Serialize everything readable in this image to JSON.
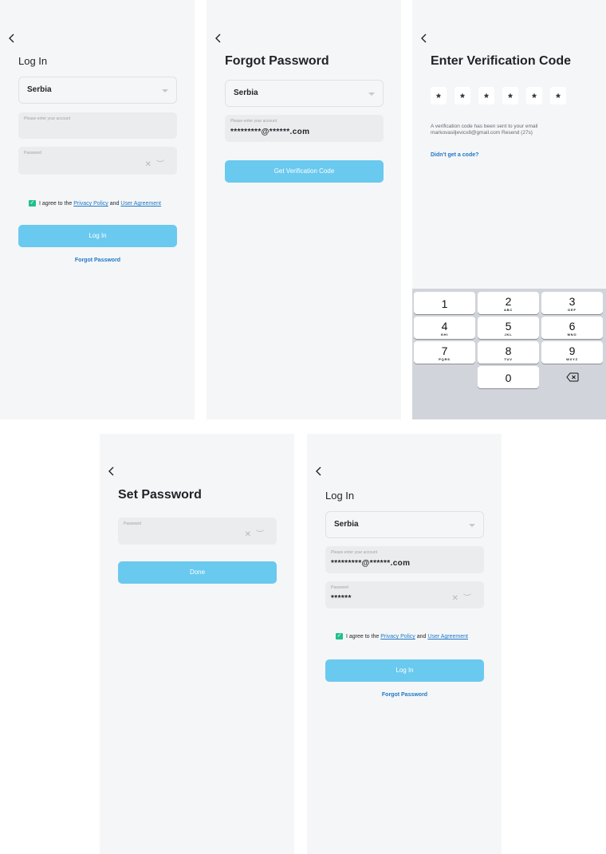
{
  "screen1": {
    "title": "Log In",
    "country": "Serbia",
    "account_placeholder": "Please enter your account",
    "password_label": "Password",
    "agree_prefix": "I agree to the",
    "privacy_link": "Privacy Policy",
    "agree_and": "and",
    "user_agreement_link": "User Agreement",
    "login_button": "Log In",
    "forgot_link": "Forgot Password"
  },
  "screen2": {
    "title": "Forgot Password",
    "country": "Serbia",
    "account_label": "Please enter your account",
    "account_value": "*********@******.com",
    "get_code_button": "Get Verification Code"
  },
  "screen3": {
    "title": "Enter Verification Code",
    "code_digits": [
      "*",
      "*",
      "*",
      "*",
      "*",
      "*"
    ],
    "info_line1": "A verification code has been sent to your email",
    "info_line2": "markovasiljevicx8@gmail.com  Resend (27s)",
    "didnt_get_code": "Didn't get a code?",
    "keypad": [
      {
        "digit": "1",
        "letters": ""
      },
      {
        "digit": "2",
        "letters": "ABC"
      },
      {
        "digit": "3",
        "letters": "DEF"
      },
      {
        "digit": "4",
        "letters": "GHI"
      },
      {
        "digit": "5",
        "letters": "JKL"
      },
      {
        "digit": "6",
        "letters": "MNO"
      },
      {
        "digit": "7",
        "letters": "PQRS"
      },
      {
        "digit": "8",
        "letters": "TUV"
      },
      {
        "digit": "9",
        "letters": "WXYZ"
      },
      {
        "digit": "0",
        "letters": ""
      }
    ]
  },
  "screen4": {
    "title": "Set Password",
    "password_label": "Password",
    "done_button": "Done"
  },
  "screen5": {
    "title": "Log In",
    "country": "Serbia",
    "account_label": "Please enter your account",
    "account_value": "*********@******.com",
    "password_label": "Password",
    "password_value": "******",
    "agree_prefix": "I agree to the",
    "privacy_link": "Privacy Policy",
    "agree_and": "and",
    "user_agreement_link": "User Agreement",
    "login_button": "Log In",
    "forgot_link": "Forgot Password"
  },
  "colors": {
    "background": "#f5f6f7",
    "accent_button": "#6ac9ee",
    "link": "#1e78c8",
    "checkbox": "#21c08b"
  },
  "icons": {
    "back": "chevron-left-icon",
    "dropdown": "chevron-down-icon",
    "clear": "close-icon",
    "visibility": "eye-closed-icon",
    "checkbox": "check-icon",
    "delete": "backspace-icon"
  }
}
